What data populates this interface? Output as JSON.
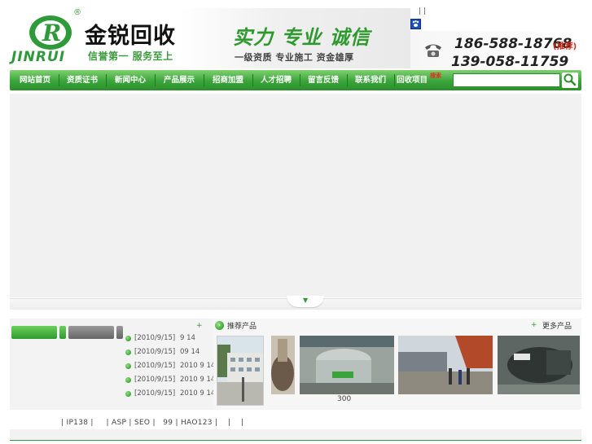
{
  "header": {
    "logo_latin": "JINRUI",
    "logo_reg": "®",
    "brand_title": "金锐回收",
    "brand_sub": "信誉第一 服务至上",
    "slogan": "实力 专业 诚信",
    "slogan_sub": "一级资质 专业施工 资金雄厚",
    "top_links": "|   |",
    "phone1": "186-588-18768",
    "phone1_tag": "(推荐)",
    "phone2": "139-058-11759"
  },
  "nav": {
    "items": [
      "网站首页",
      "资质证书",
      "新闻中心",
      "产品展示",
      "招商加盟",
      "人才招聘",
      "留言反馈",
      "联系我们",
      "回收项目"
    ],
    "search_label": "搜索",
    "search_placeholder": ""
  },
  "news": {
    "more": "+",
    "items": [
      {
        "date": "[2010/9/15]",
        "title": "9 14"
      },
      {
        "date": "[2010/9/15]",
        "title": "09 14"
      },
      {
        "date": "[2010/9/15]",
        "title": "2010 9 14"
      },
      {
        "date": "[2010/9/15]",
        "title": "2010 9 14"
      },
      {
        "date": "[2010/9/15]",
        "title": "2010 9 14"
      }
    ]
  },
  "products": {
    "title": "推荐产品",
    "more": "更多产品",
    "count": "300"
  },
  "footer": {
    "links": "| IP138 |     | ASP | SEO |   99 | HAO123 |    |    |"
  },
  "colors": {
    "accent": "#3aa43a",
    "accent_dark": "#2b8f2b",
    "phone_tag": "#d02a1a"
  }
}
